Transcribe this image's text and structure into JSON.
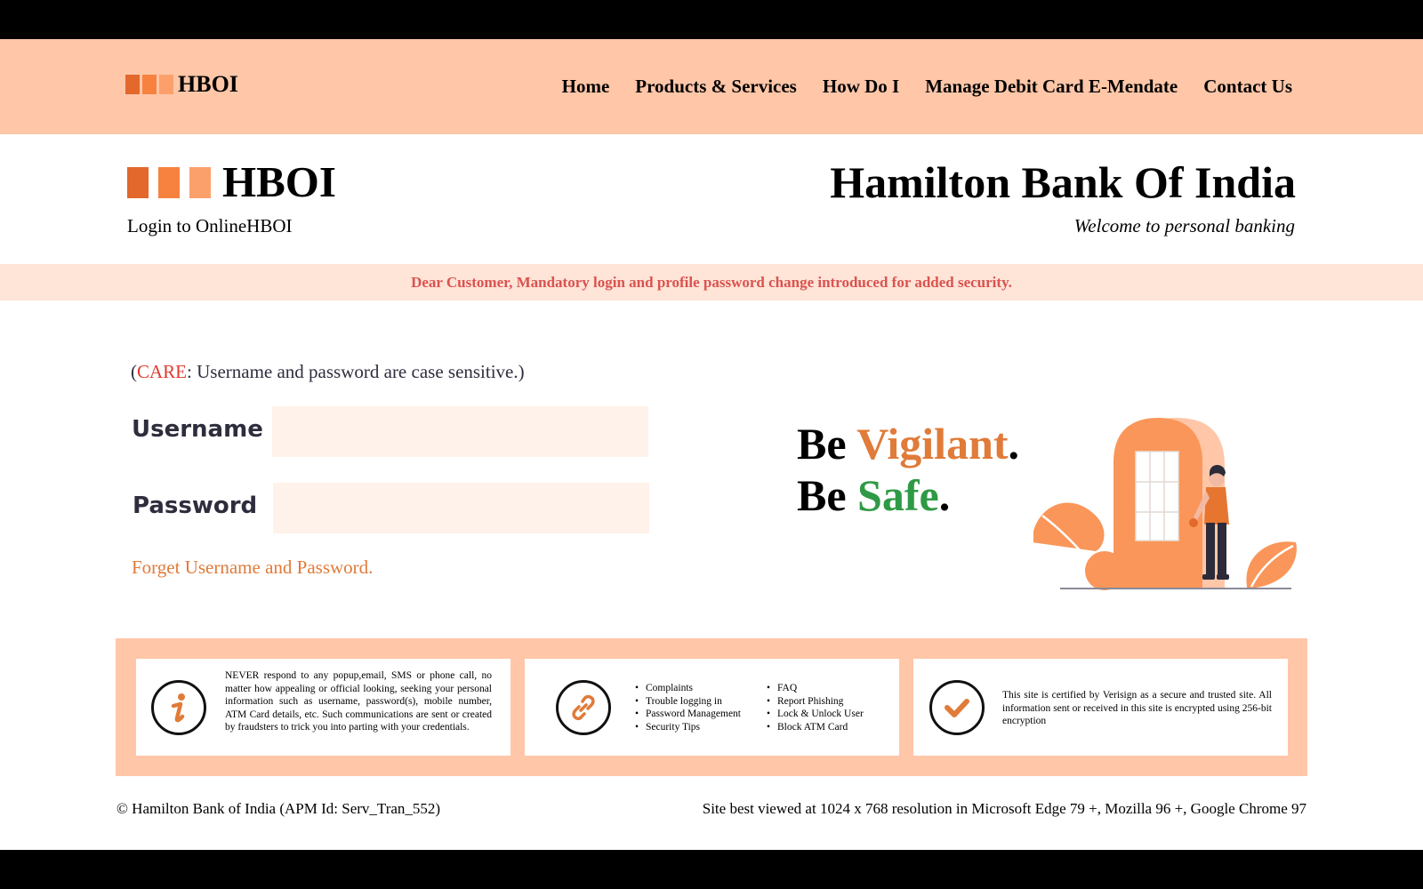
{
  "colors": {
    "brand_primary": "#e07b39",
    "brand_light": "#ffc6a8",
    "logo_squares": [
      "#e2682c",
      "#f7823f",
      "#fca06b"
    ],
    "notice_text": "#d9534f",
    "safe_green": "#2f9a45"
  },
  "navbar": {
    "brand": "HBOI",
    "links": [
      "Home",
      "Products & Services",
      "How Do I",
      "Manage Debit Card E-Mendate",
      "Contact Us"
    ]
  },
  "header": {
    "brand": "HBOI",
    "login_subtitle": "Login to OnlineHBOI",
    "bank_name": "Hamilton Bank Of India",
    "welcome": "Welcome to personal banking"
  },
  "notice": "Dear Customer, Mandatory login and profile password change introduced for added security.",
  "login": {
    "care_open": "(",
    "care_word": "CARE",
    "care_rest": ": Username and password are case sensitive.)",
    "username_label": "Username",
    "password_label": "Password",
    "username_value": "",
    "password_value": "",
    "forgot_link": "Forget Username and Password."
  },
  "slogan": {
    "be1": "Be ",
    "word1": "Vigilant",
    "dot1": ".",
    "be2": "Be ",
    "word2": "Safe",
    "dot2": "."
  },
  "info_cards": {
    "warning_text": "NEVER respond to any popup,email, SMS or phone call, no matter how appealing or official looking, seeking your personal information such as username, password(s), mobile number, ATM Card details, etc. Such communications are sent or created by fraudsters to trick you into parting with your credentials.",
    "links_col1": [
      "Complaints",
      "Trouble logging in",
      "Password Management",
      "Security Tips"
    ],
    "links_col2": [
      "FAQ",
      "Report Phishing",
      "Lock & Unlock User",
      "Block ATM Card"
    ],
    "security_text": "This site is certified by Verisign as a secure and trusted site. All information sent or received in this site is encrypted using 256-bit encryption",
    "icons": [
      "info-icon",
      "link-icon",
      "check-icon"
    ]
  },
  "footer": {
    "copyright": "© Hamilton Bank of India (APM Id: Serv_Tran_552)",
    "browser_note": "Site best viewed at 1024 x 768 resolution in Microsoft Edge 79 +, Mozilla 96 +, Google Chrome 97"
  }
}
